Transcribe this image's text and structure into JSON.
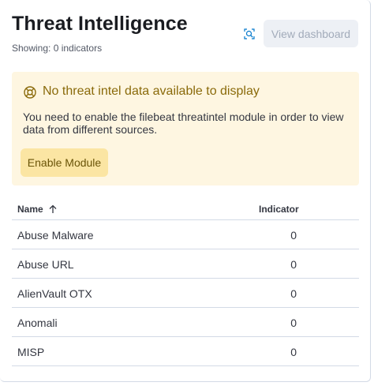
{
  "header": {
    "title": "Threat Intelligence",
    "subtitle": "Showing: 0 indicators",
    "inspect_icon": "inspect-icon",
    "view_dashboard_label": "View dashboard"
  },
  "callout": {
    "icon": "help-circle-icon",
    "title": "No threat intel data available to display",
    "body": "You need to enable the filebeat threatintel module in order to view data from different sources.",
    "button_label": "Enable Module"
  },
  "table": {
    "columns": {
      "name": "Name",
      "indicator": "Indicator"
    },
    "sort_icon": "arrow-up-icon",
    "rows": [
      {
        "name": "Abuse Malware",
        "value": "0"
      },
      {
        "name": "Abuse URL",
        "value": "0"
      },
      {
        "name": "AlienVault OTX",
        "value": "0"
      },
      {
        "name": "Anomali",
        "value": "0"
      },
      {
        "name": "MISP",
        "value": "0"
      }
    ]
  },
  "colors": {
    "warning_bg": "#fef6e1",
    "warning_button": "#fbe5a3",
    "accent": "#0077cc"
  }
}
